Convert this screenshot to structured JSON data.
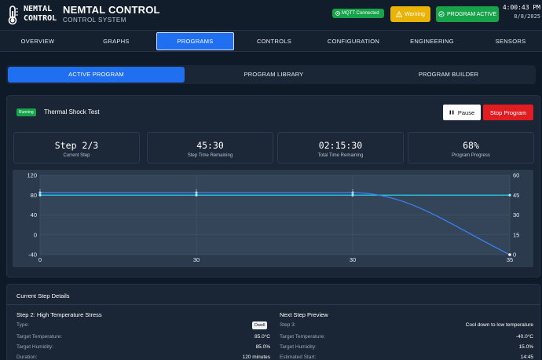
{
  "header": {
    "logo_line1": "NEMTAL",
    "logo_line2": "CONTROL",
    "title": "NEMTAL CONTROL",
    "subtitle": "CONTROL SYSTEM",
    "mqtt_label": "MQTT Connected",
    "warning_label": "Warning",
    "program_label": "PROGRAM ACTIVE",
    "time": "4:00:43 PM",
    "date": "8/8/2025"
  },
  "nav": {
    "tabs": [
      {
        "label": "OVERVIEW"
      },
      {
        "label": "GRAPHS"
      },
      {
        "label": "PROGRAMS"
      },
      {
        "label": "CONTROLS"
      },
      {
        "label": "CONFIGURATION"
      },
      {
        "label": "ENGINEERING"
      },
      {
        "label": "SENSORS"
      }
    ],
    "active": "PROGRAMS"
  },
  "subtabs": {
    "tabs": [
      {
        "label": "ACTIVE PROGRAM"
      },
      {
        "label": "PROGRAM LIBRARY"
      },
      {
        "label": "PROGRAM BUILDER"
      }
    ],
    "active": "ACTIVE PROGRAM"
  },
  "program": {
    "status_badge": "Running",
    "name": "Thermal Shock Test",
    "pause_label": "Pause",
    "stop_label": "Stop Program",
    "stats": [
      {
        "value": "Step 2/3",
        "label": "Current Step"
      },
      {
        "value": "45:30",
        "label": "Step Time Remaining"
      },
      {
        "value": "02:15:30",
        "label": "Total Time Remaining"
      },
      {
        "value": "68%",
        "label": "Program Progress"
      }
    ]
  },
  "chart_data": {
    "type": "line",
    "x_ticks": [
      "0",
      "30",
      "30",
      "35"
    ],
    "y_left_ticks": [
      120,
      80,
      40,
      0,
      -40
    ],
    "y_right_ticks": [
      60,
      45,
      30,
      15,
      0
    ],
    "ylim_left": [
      -40,
      120
    ],
    "ylim_right": [
      0,
      60
    ],
    "grid": true,
    "series": [
      {
        "axis": "left",
        "color": "#3b82f6",
        "points": [
          [
            0,
            85
          ],
          [
            1,
            85
          ],
          [
            2,
            85
          ],
          [
            3,
            -40
          ]
        ]
      },
      {
        "axis": "right",
        "color": "#22d3ee",
        "points": [
          [
            0,
            45
          ],
          [
            1,
            45
          ],
          [
            2,
            45
          ],
          [
            3,
            45
          ]
        ]
      }
    ]
  },
  "details": {
    "title": "Current Step Details",
    "current": {
      "heading": "Step 2: High Temperature Stress",
      "rows": [
        {
          "label": "Type:",
          "value": "Dwell"
        },
        {
          "label": "Target Temperature:",
          "value": "85.0°C"
        },
        {
          "label": "Target Humidity:",
          "value": "85.0%"
        },
        {
          "label": "Duration:",
          "value": "120 minutes"
        }
      ]
    },
    "next": {
      "heading": "Next Step Preview",
      "rows": [
        {
          "label": "Step 3:",
          "value": "Cool down to low temperature"
        },
        {
          "label": "Target Temperature:",
          "value": "-40.0°C"
        },
        {
          "label": "Target Humidity:",
          "value": "15.0%"
        },
        {
          "label": "Estimated Start:",
          "value": "14:45"
        }
      ]
    }
  },
  "colors": {
    "accent": "#1f6ff0",
    "success": "#16a34a",
    "warning": "#eab308",
    "danger": "#e11d22"
  }
}
